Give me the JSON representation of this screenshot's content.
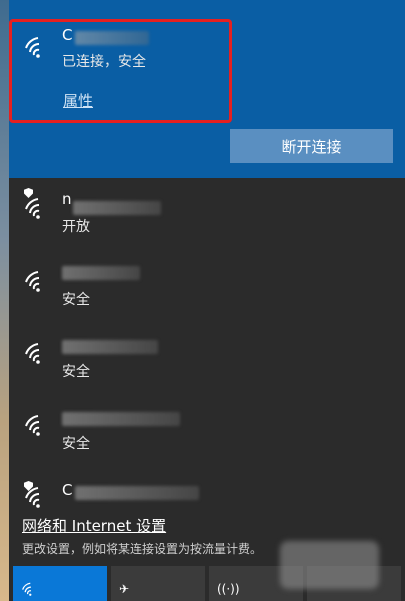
{
  "connected_network": {
    "name_hint": "C",
    "status": "已连接，安全",
    "properties_link": "属性",
    "disconnect_button": "断开连接"
  },
  "networks": [
    {
      "name_hint": "n",
      "status": "开放",
      "secured": false
    },
    {
      "name_hint": "",
      "status": "安全",
      "secured": true
    },
    {
      "name_hint": "",
      "status": "安全",
      "secured": true
    },
    {
      "name_hint": "",
      "status": "安全",
      "secured": true
    },
    {
      "name_hint": "C",
      "status": "",
      "secured": false
    }
  ],
  "settings": {
    "link": "网络和 Internet 设置",
    "description": "更改设置，例如将某连接设置为按流量计费。"
  },
  "quick_actions": [
    {
      "icon": "wifi-icon",
      "active": true
    },
    {
      "icon": "airplane-icon",
      "active": false
    },
    {
      "icon": "hotspot-icon",
      "active": false
    }
  ],
  "colors": {
    "accent": "#0a5ea4",
    "button": "#5a8fc1",
    "highlight_border": "#e52020",
    "background": "#2b2b2b",
    "active_tile": "#0a78d7"
  }
}
